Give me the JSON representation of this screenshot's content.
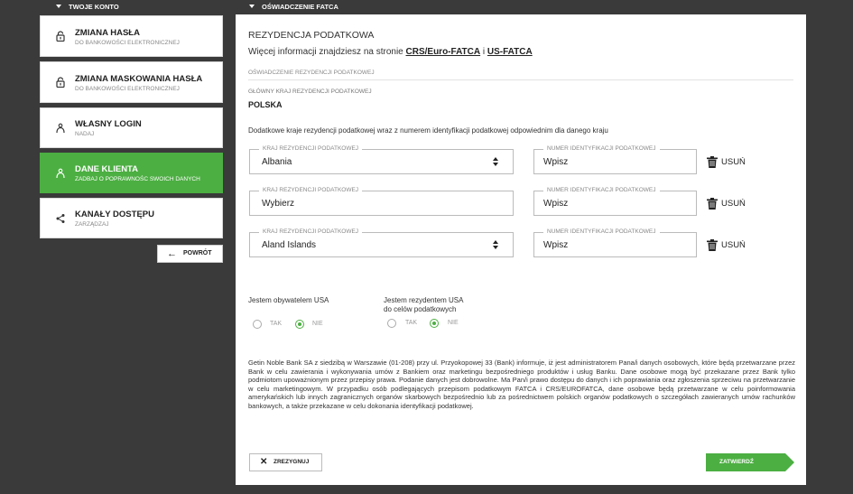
{
  "left_header": "TWOJE KONTO",
  "right_header": "OŚWIADCZENIE FATCA",
  "sidebar": {
    "items": [
      {
        "title": "ZMIANA HASŁA",
        "subtitle": "DO BANKOWOŚCI ELEKTRONICZNEJ",
        "icon": "lock-icon"
      },
      {
        "title": "ZMIANA MASKOWANIA HASŁA",
        "subtitle": "DO BANKOWOŚCI ELEKTRONICZNEJ",
        "icon": "lock-icon"
      },
      {
        "title": "WŁASNY LOGIN",
        "subtitle": "NADAJ",
        "icon": "user-icon"
      },
      {
        "title": "DANE KLIENTA",
        "subtitle": "ZADBAJ O POPRAWNOŚC SWOICH DANYCH",
        "icon": "user-icon",
        "active": true
      },
      {
        "title": "KANAŁY DOSTĘPU",
        "subtitle": "ZARZĄDZAJ",
        "icon": "share-icon"
      }
    ],
    "back_label": "POWRÓT"
  },
  "panel": {
    "section_title": "REZYDENCJA PODATKOWA",
    "info_prefix": "Więcej informacji znajdziesz na stronie",
    "info_link1": "CRS/Euro-FATCA",
    "info_and": "i",
    "info_link2": "US-FATCA",
    "subsection": "OŚWIADCZENIE REZYDENCJI PODATKOWEJ",
    "main_country_label": "GŁÓWNY KRAJ REZYDENCJI PODATKOWEJ",
    "main_country_value": "POLSKA",
    "additional_desc": "Dodatkowe kraje rezydencji podatkowej wraz z numerem identyfikacji podatkowej odpowiednim dla danego kraju",
    "rows": [
      {
        "country_label": "KRAJ REZYDENCJI PODATKOWEJ",
        "country": "Albania",
        "tin_label": "NUMER IDENTYFIKACJI PODATKOWEJ",
        "tin": "Wpisz",
        "remove": "USUŃ"
      },
      {
        "country_label": "KRAJ REZYDENCJI PODATKOWEJ",
        "country": "Wybierz",
        "tin_label": "NUMER IDENTYFIKACJI PODATKOWEJ",
        "tin": "Wpisz",
        "remove": "USUŃ"
      },
      {
        "country_label": "KRAJ REZYDENCJI PODATKOWEJ",
        "country": "Aland Islands",
        "tin_label": "NUMER IDENTYFIKACJI PODATKOWEJ",
        "tin": "Wpisz",
        "remove": "USUŃ"
      }
    ],
    "q_citizen": "Jestem obywatelem USA",
    "q_resident_line1": "Jestem rezydentem USA",
    "q_resident_line2": "do celów podatkowych",
    "yes": "TAK",
    "no": "NIE",
    "citizen_selected": "NIE",
    "resident_selected": "NIE",
    "legal_text": "Getin Noble Bank SA z siedzibą w Warszawie (01-208) przy ul. Przyokopowej 33 (Bank) informuje, iż jest administratorem Pana/i danych osobowych, które będą przetwarzane przez Bank w celu zawierania i wykonywania umów z Bankiem oraz marketingu bezpośredniego produktów i usług Banku. Dane osobowe mogą być przekazane przez Bank tylko podmiotom upoważnionym przez przepisy prawa. Podanie danych jest dobrowolne. Ma Pan/i prawo dostępu do danych i ich poprawiania oraz zgłoszenia sprzeciwu na przetwarzanie w celu marketingowym. W przypadku osób podlegających przepisom podatkowym FATCA i CRS/EUROFATCA, dane osobowe będą przetwarzane w celu poinformowania amerykańskich lub innych zagranicznych organów skarbowych bezpośrednio lub za pośrednictwem polskich organów podatkowych o szczegółach zawieranych umów rachunków bankowych, a także przekazane w celu dokonania identyfikacji podatkowej.",
    "resign_label": "ZREZYGNUJ",
    "confirm_label": "ZATWIERDŹ"
  },
  "colors": {
    "accent": "#4caf42",
    "background": "#3a3a3a"
  }
}
